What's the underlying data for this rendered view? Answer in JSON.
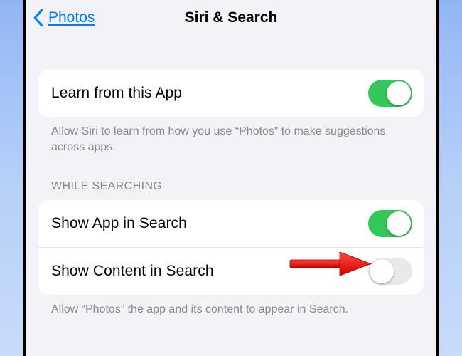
{
  "nav": {
    "back_label": "Photos",
    "title": "Siri & Search"
  },
  "section1": {
    "row1_label": "Learn from this App",
    "row1_on": true,
    "footer": "Allow Siri to learn from how you use “Photos” to make suggestions across apps."
  },
  "section2": {
    "header": "WHILE SEARCHING",
    "row1_label": "Show App in Search",
    "row1_on": true,
    "row2_label": "Show Content in Search",
    "row2_on": false,
    "footer": "Allow “Photos” the app and its content to appear in Search."
  },
  "colors": {
    "accent": "#007aff",
    "switch_on": "#34c759"
  }
}
